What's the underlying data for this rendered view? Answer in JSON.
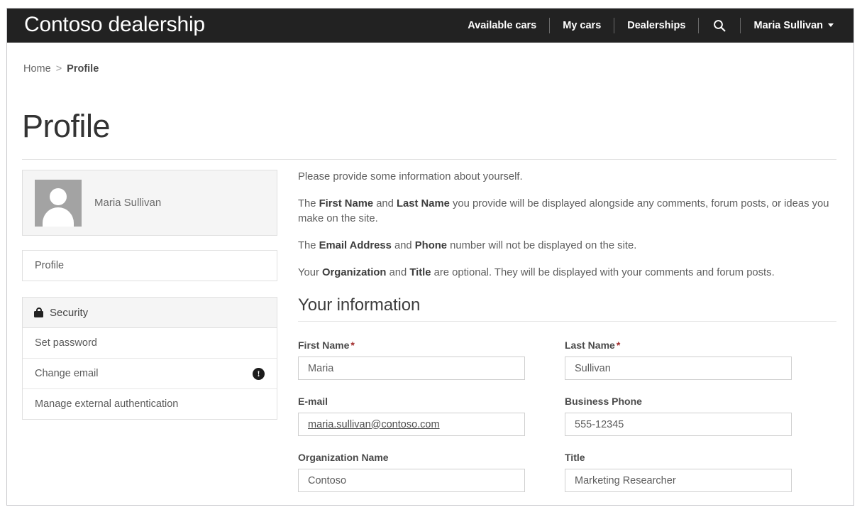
{
  "navbar": {
    "brand": "Contoso dealership",
    "links": [
      {
        "label": "Available cars"
      },
      {
        "label": "My cars"
      },
      {
        "label": "Dealerships"
      }
    ],
    "search_icon": "search-icon",
    "user": "Maria Sullivan"
  },
  "breadcrumb": {
    "home": "Home",
    "separator": ">",
    "current": "Profile"
  },
  "page": {
    "title": "Profile"
  },
  "sidebar": {
    "avatar_name": "Maria Sullivan",
    "profile_item": "Profile",
    "security_header": "Security",
    "security_icon": "lock-icon",
    "security_items": [
      {
        "label": "Set password",
        "badge": ""
      },
      {
        "label": "Change email",
        "badge": "!"
      },
      {
        "label": "Manage external authentication",
        "badge": ""
      }
    ]
  },
  "main": {
    "intro1": "Please provide some information about yourself.",
    "intro2_a": "The ",
    "intro2_b1": "First Name",
    "intro2_c": " and ",
    "intro2_b2": "Last Name",
    "intro2_d": " you provide will be displayed alongside any comments, forum posts, or ideas you make on the site.",
    "intro3_a": "The ",
    "intro3_b1": "Email Address",
    "intro3_c": " and ",
    "intro3_b2": "Phone",
    "intro3_d": " number will not be displayed on the site.",
    "intro4_a": "Your ",
    "intro4_b1": "Organization",
    "intro4_c": " and ",
    "intro4_b2": "Title",
    "intro4_d": " are optional. They will be displayed with your comments and forum posts.",
    "section_heading": "Your information",
    "fields": {
      "first_name": {
        "label": "First Name",
        "required": "*",
        "value": "Maria"
      },
      "last_name": {
        "label": "Last Name",
        "required": "*",
        "value": "Sullivan"
      },
      "email": {
        "label": "E-mail",
        "value": "maria.sullivan@contoso.com"
      },
      "business_phone": {
        "label": "Business Phone",
        "value": "555-12345"
      },
      "organization": {
        "label": "Organization Name",
        "value": "Contoso"
      },
      "title": {
        "label": "Title",
        "value": "Marketing Researcher"
      }
    }
  },
  "colors": {
    "navbar_bg": "#222222",
    "required_star": "#a12b2b",
    "panel_bg": "#f5f5f5",
    "border": "#e0e0e0"
  }
}
